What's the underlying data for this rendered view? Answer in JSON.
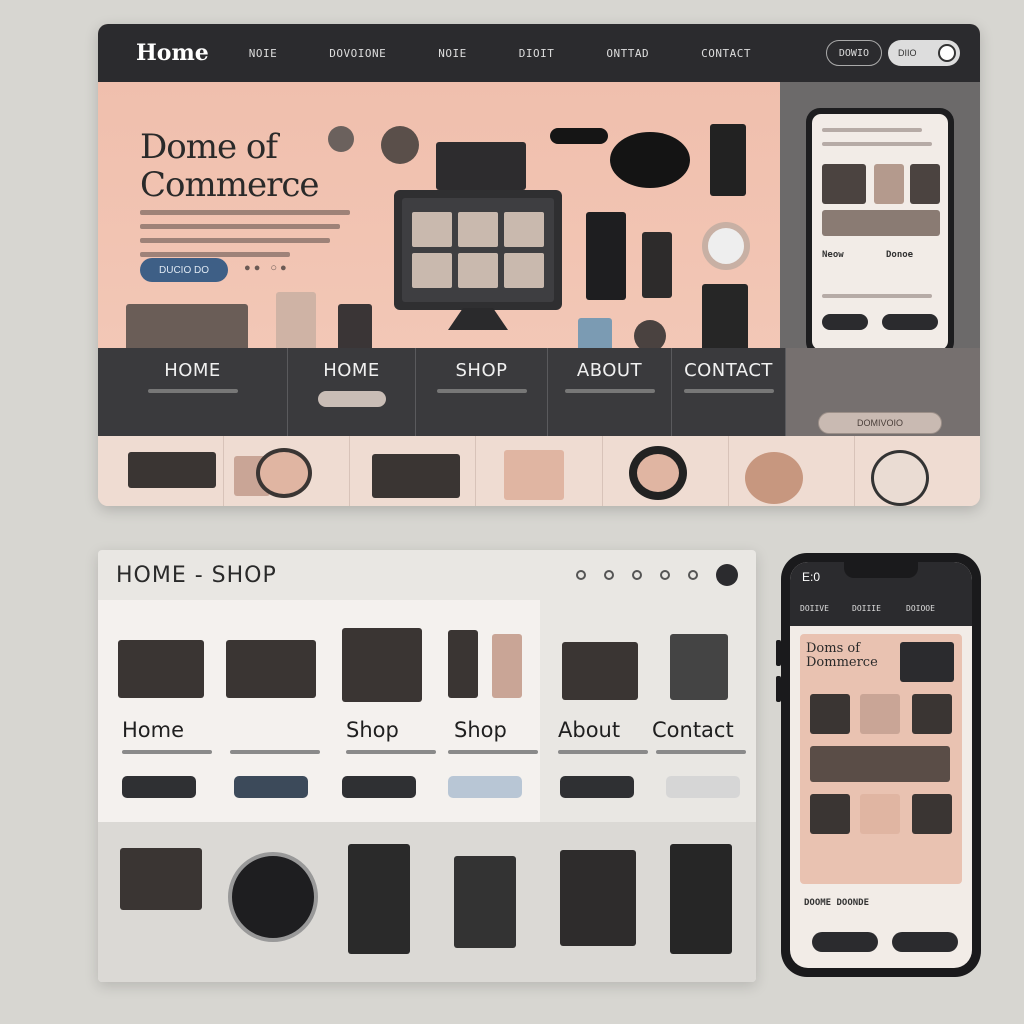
{
  "top_site": {
    "brand": "Home",
    "nav_links": [
      "NOIE",
      "DOVOIONE",
      "NOIE",
      "DIOIT",
      "ONTTAD",
      "CONTACT"
    ],
    "search_label": "DOWIO",
    "toggle_label": "DIIO",
    "hero": {
      "title_line1": "Dome of",
      "title_line2": "Commerce",
      "cta_label": "DUCIO DO"
    },
    "phone": {
      "label_left": "Neow",
      "label_right": "Donoe"
    },
    "nav_strip": [
      "HOME",
      "HOME",
      "SHOP",
      "ABOUT",
      "CONTACT"
    ],
    "side_pill_label": "DOMIVOIO"
  },
  "bottom_site": {
    "title": "HOME - SHOP",
    "cards": [
      "Home",
      "Shop",
      "Shop",
      "About",
      "Contact"
    ]
  },
  "bottom_phone": {
    "status_time": "E:0",
    "tabs": [
      "DOIIVE",
      "DOIIIE",
      "DOIOOE"
    ],
    "title_line1": "Doms of",
    "title_line2": "Dommerce",
    "footer_labels": "DOOME DOONDE"
  },
  "colors": {
    "dark_nav": "#2b2b2e",
    "hero_peach": "#f0bfad",
    "cta_blue": "#3e5f86",
    "background": "#d7d6d1"
  }
}
